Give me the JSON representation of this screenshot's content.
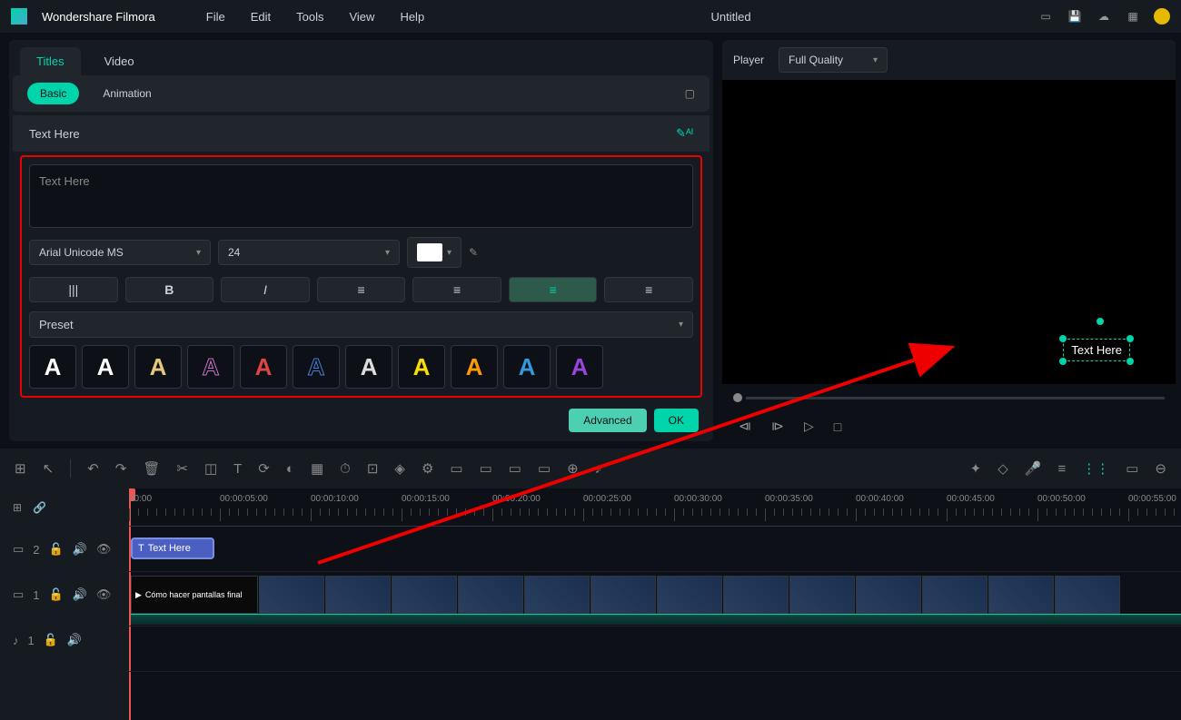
{
  "app": {
    "name": "Wondershare Filmora",
    "doc": "Untitled"
  },
  "menu": {
    "file": "File",
    "edit": "Edit",
    "tools": "Tools",
    "view": "View",
    "help": "Help"
  },
  "tabs": {
    "titles": "Titles",
    "video": "Video"
  },
  "subtabs": {
    "basic": "Basic",
    "animation": "Animation"
  },
  "section": {
    "header": "Text Here"
  },
  "textbox": {
    "value": "Text Here"
  },
  "font": {
    "family": "Arial Unicode MS",
    "size": "24"
  },
  "preset": {
    "label": "Preset"
  },
  "actions": {
    "advanced": "Advanced",
    "ok": "OK"
  },
  "player": {
    "label": "Player",
    "quality": "Full Quality",
    "overlay": "Text Here"
  },
  "timeline": {
    "ticks": [
      "00:00",
      "00:00:05:00",
      "00:00:10:00",
      "00:00:15:00",
      "00:00:20:00",
      "00:00:25:00",
      "00:00:30:00",
      "00:00:35:00",
      "00:00:40:00",
      "00:00:45:00",
      "00:00:50:00",
      "00:00:55:00"
    ],
    "text_clip": "Text Here",
    "video_clip": "Cómo hacer pantallas final",
    "track_text": "2",
    "track_video": "1",
    "track_audio": "1"
  }
}
